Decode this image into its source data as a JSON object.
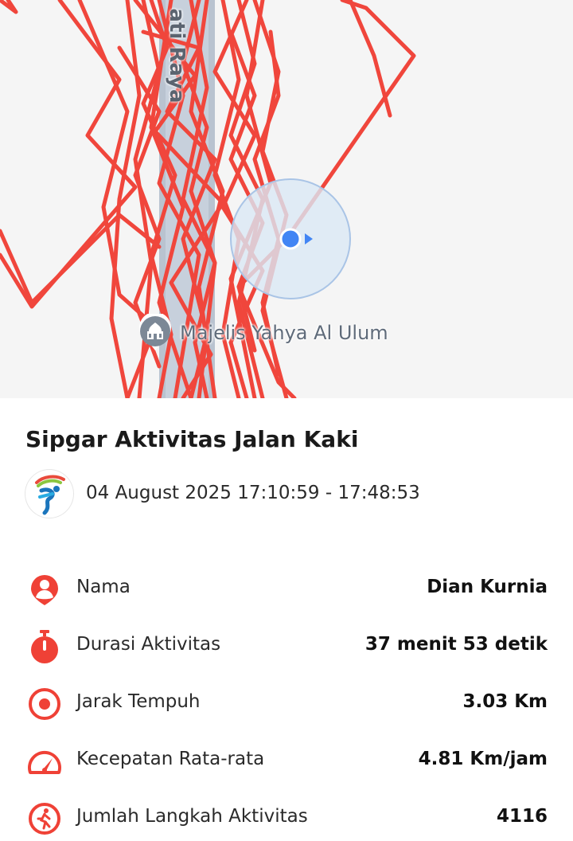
{
  "map": {
    "road_label": "ati Raya",
    "poi_label": "Majelis Yahya Al Ulum",
    "route_color": "#f0463c",
    "location_dot_color": "#4285f4"
  },
  "activity": {
    "title": "Sipgar Aktivitas Jalan Kaki",
    "datetime": "04 August 2025 17:10:59 - 17:48:53",
    "logo_icon": "sipgar-logo"
  },
  "stats": [
    {
      "label": "Nama",
      "value": "Dian Kurnia",
      "icon": "person-icon"
    },
    {
      "label": "Durasi Aktivitas",
      "value": "37 menit 53 detik",
      "icon": "stopwatch-icon"
    },
    {
      "label": "Jarak Tempuh",
      "value": "3.03 Km",
      "icon": "target-icon"
    },
    {
      "label": "Kecepatan Rata-rata",
      "value": "4.81 Km/jam",
      "icon": "speedometer-icon"
    },
    {
      "label": "Jumlah Langkah Aktivitas",
      "value": "4116",
      "icon": "walking-icon"
    }
  ],
  "colors": {
    "accent": "#ef4136"
  }
}
